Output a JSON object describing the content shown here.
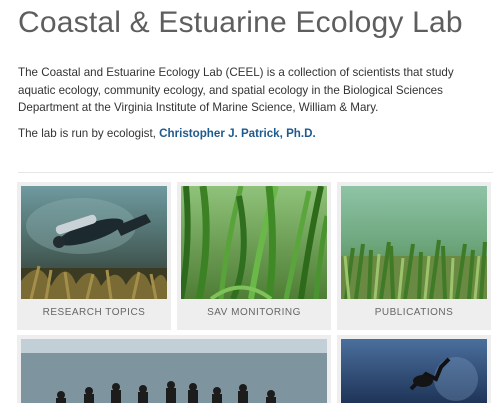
{
  "page": {
    "title": "Coastal & Estuarine Ecology Lab",
    "intro": "The Coastal and Estuarine Ecology Lab (CEEL) is a collection of scientists that study aquatic ecology, community ecology, and spatial ecology in the Biological Sciences Department at the Virginia Institute of Marine Science, William & Mary.",
    "runby_prefix": "The lab is run by ecologist, ",
    "runby_link": "Christopher J. Patrick, Ph.D."
  },
  "cards": {
    "research": {
      "label": "RESEARCH TOPICS"
    },
    "sav": {
      "label": "SAV MONITORING"
    },
    "publications": {
      "label": "PUBLICATIONS"
    }
  },
  "colors": {
    "title": "#5e5e5e",
    "link": "#1f5a8c",
    "card_bg": "#eeeeee",
    "label": "#666666"
  }
}
